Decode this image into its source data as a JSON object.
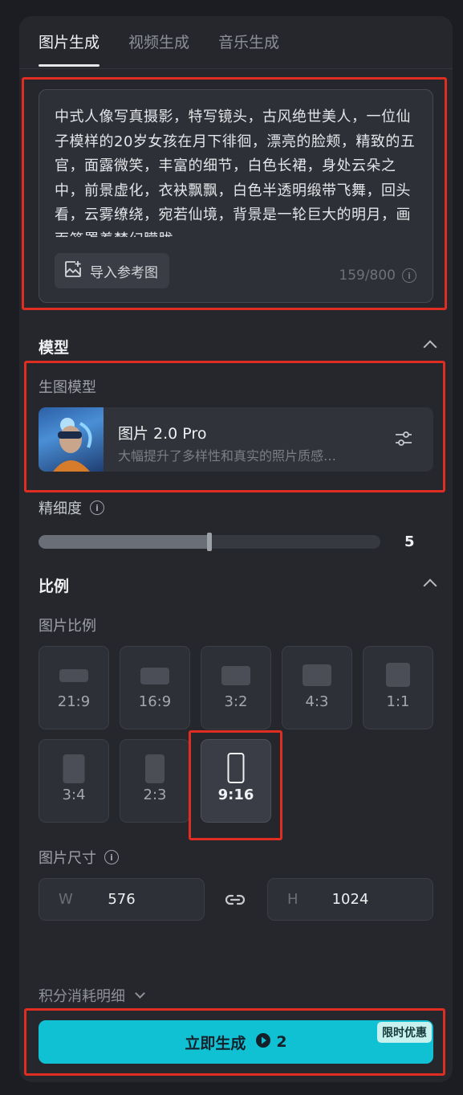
{
  "tabs": [
    {
      "label": "图片生成",
      "active": true
    },
    {
      "label": "视频生成",
      "active": false
    },
    {
      "label": "音乐生成",
      "active": false
    }
  ],
  "prompt": {
    "text": "中式人像写真摄影，特写镜头，古风绝世美人，一位仙子模样的20岁女孩在月下徘徊，漂亮的脸颊，精致的五官，面露微笑，丰富的细节，白色长裙，身处云朵之中，前景虚化，衣袂飘飘，白色半透明缎带飞舞，回头看，云雾缭绕，宛若仙境，背景是一轮巨大的明月，画面笼罩着梦幻朦胧",
    "ref_button": "导入参考图",
    "counter": "159/800"
  },
  "model_section": {
    "title": "模型",
    "label": "生图模型",
    "model_name": "图片 2.0 Pro",
    "model_desc": "大幅提升了多样性和真实的照片质感…"
  },
  "fineness": {
    "label": "精细度",
    "value": "5",
    "fraction": 0.5
  },
  "ratio_section": {
    "title": "比例",
    "label": "图片比例",
    "options": [
      "21:9",
      "16:9",
      "3:2",
      "4:3",
      "1:1",
      "3:4",
      "2:3",
      "9:16"
    ],
    "selected": "9:16"
  },
  "size": {
    "label": "图片尺寸",
    "w_prefix": "W",
    "w_value": "576",
    "h_prefix": "H",
    "h_value": "1024"
  },
  "credits_label": "积分消耗明细",
  "generate": {
    "label": "立即生成",
    "cost": "2",
    "promo": "限时优惠"
  },
  "colors": {
    "accent": "#10c1d3",
    "highlight_box": "#e02d22",
    "panel": "#25272d"
  }
}
